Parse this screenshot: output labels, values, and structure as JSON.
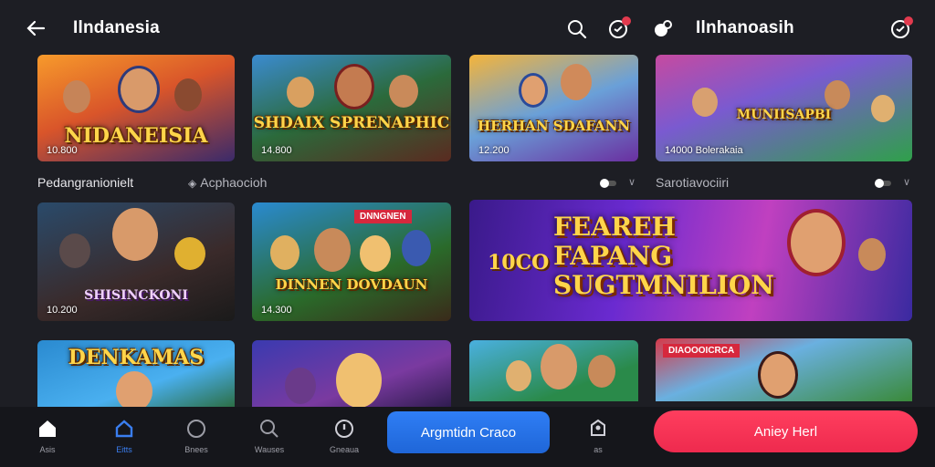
{
  "header_left": {
    "title": "Ilndanesia"
  },
  "header_right": {
    "title": "Ilnhanoasih"
  },
  "row1": [
    {
      "title": "NIDANEISIA",
      "count": "10.800"
    },
    {
      "title": "SHDAIX SPRENAPHIC",
      "count": "14.800"
    },
    {
      "title": "HERHAN SDAFANN",
      "count": "12.200"
    },
    {
      "title": "MUNIISAPBI",
      "count": "14000 Bolerakaia"
    }
  ],
  "section_labels": {
    "left": "Pedangranionielt",
    "middle": "Acphaocioh",
    "right": "Sarotiavociiri"
  },
  "row2": [
    {
      "title": "SHISINCKONI",
      "count": "10.200"
    },
    {
      "title": "DINNEN DOVDAUN",
      "count": "14.300",
      "ribbon": "DNNGNEN"
    },
    {
      "title": "FEAREH FAPANG SUGTMNILION",
      "prefix": "10CO"
    }
  ],
  "row3": [
    {
      "title": "DENKAMAS"
    },
    {
      "title": ""
    },
    {
      "title": ""
    },
    {
      "title": "",
      "ribbon": "DIAOOOICRCA"
    }
  ],
  "nav": [
    {
      "label": "Asis",
      "icon": "home-icon"
    },
    {
      "label": "Eitts",
      "icon": "house-outline-icon"
    },
    {
      "label": "Bnees",
      "icon": "circle-icon"
    },
    {
      "label": "Wauses",
      "icon": "search-icon"
    },
    {
      "label": "Gneaua",
      "icon": "shield-icon"
    }
  ],
  "buttons": {
    "primary": "Argmtidn Craco",
    "secondary": "Aniey Herl",
    "profile_label": "as"
  },
  "colors": {
    "background": "#1d1e24",
    "accent_blue": "#2f7ef5",
    "accent_red": "#ff3e5e",
    "title_gold": "#ffd54a"
  }
}
